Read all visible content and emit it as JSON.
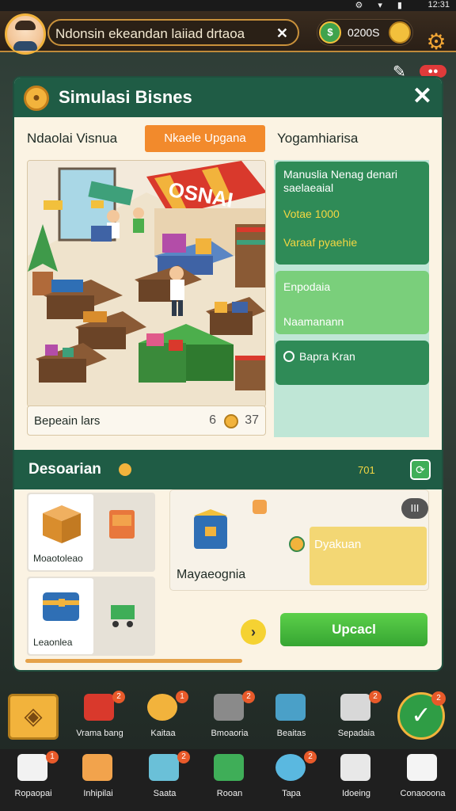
{
  "status_bar": {
    "time": "12:31"
  },
  "top_bar": {
    "search_text": "Ndonsin ekeandan laiiad drtaoa",
    "currency_value": "0200S",
    "money_symbol": "$"
  },
  "panel": {
    "title": "Simulasi Bisnes",
    "tabs": [
      {
        "label": "Ndaolai Visnua",
        "active": false
      },
      {
        "label": "Nkaele Upgana",
        "active": true
      },
      {
        "label": "Yogamhiarisa",
        "active": false
      }
    ],
    "scene_sign": "OSNAI",
    "scene_caption": {
      "label": "Bepeain lars",
      "value_a": "6",
      "value_b": "37"
    },
    "cards": {
      "card1_line1": "Manuslia Nenag denari saelaeaial",
      "card1_line2": "Votae 1000",
      "card1_line3": "Varaaf pyaehie",
      "card2_line1": "Enpodaia",
      "card2_line2": "Naamanann",
      "card3_line1": "Bapra Kran"
    },
    "section": {
      "title": "Desoarian",
      "meta": "701",
      "items": [
        {
          "label": "Moaotoleao"
        },
        {
          "label": "Leaonlea"
        }
      ],
      "detail_label": "Mayaeognia",
      "detail_badge": "III",
      "detail_side": "Dyakuan",
      "arrow": "›",
      "upgrade_label": "Upcacl"
    }
  },
  "toolbar_top": [
    {
      "label": "Vrama bang",
      "badge": "2"
    },
    {
      "label": "Kaitaa",
      "badge": "1"
    },
    {
      "label": "Bmoaoria",
      "badge": "2"
    },
    {
      "label": "Beaitas",
      "badge": ""
    },
    {
      "label": "Sepadaia",
      "badge": "2"
    }
  ],
  "toolbar_bottom": [
    {
      "label": "Ropaopai",
      "badge": "1"
    },
    {
      "label": "Inhipilai",
      "badge": ""
    },
    {
      "label": "Saata",
      "badge": "2"
    },
    {
      "label": "Rooan",
      "badge": ""
    },
    {
      "label": "Tapa",
      "badge": "2"
    },
    {
      "label": "Idoeing",
      "badge": ""
    },
    {
      "label": "Conaooona",
      "badge": ""
    }
  ],
  "colors": {
    "header_green": "#1f5c45",
    "accent_orange": "#f28a2c",
    "upgrade_green": "#36a532",
    "gold": "#f2b33c"
  },
  "icons": [
    "search-icon",
    "gear-icon",
    "close-icon",
    "coin-icon",
    "check-icon",
    "arrow-right-icon"
  ]
}
